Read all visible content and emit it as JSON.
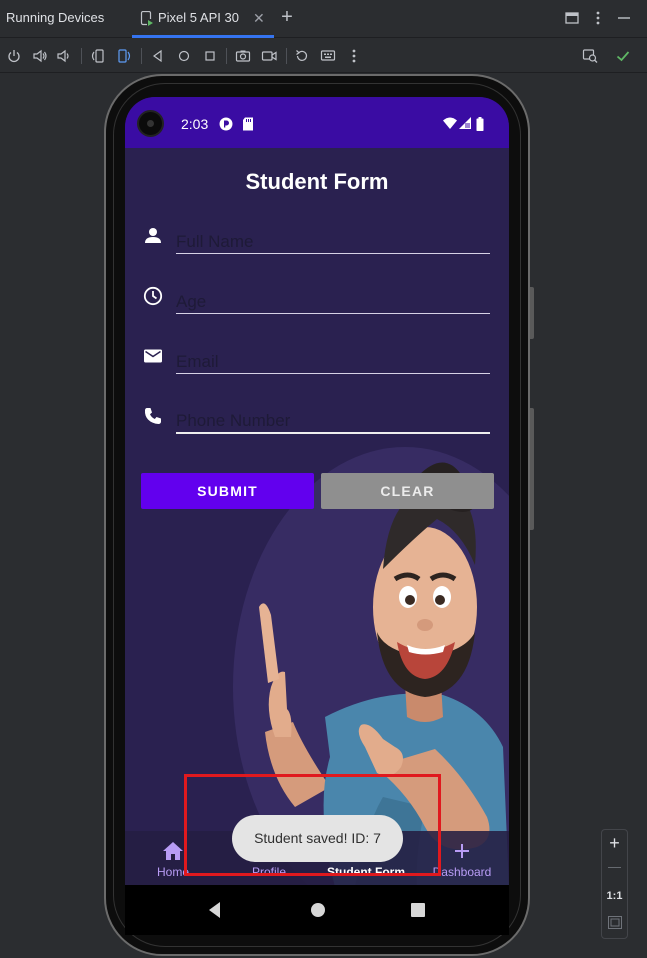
{
  "ide": {
    "panel_title": "Running Devices",
    "tab_label": "Pixel 5 API 30",
    "tab_close": "✕",
    "add_tab": "+"
  },
  "device": {
    "status_time": "2:03"
  },
  "app": {
    "title": "Student Form",
    "fields": {
      "full_name_placeholder": "Full Name",
      "age_placeholder": "Age",
      "email_placeholder": "Email",
      "phone_placeholder": "Phone Number"
    },
    "buttons": {
      "submit": "SUBMIT",
      "clear": "CLEAR"
    },
    "nav": [
      {
        "label": "Home",
        "icon": "home-icon"
      },
      {
        "label": "Profile",
        "icon": "profile-icon"
      },
      {
        "label": "Student Form",
        "icon": "student-form-icon",
        "active": true
      },
      {
        "label": "Dashboard",
        "icon": "add-icon"
      }
    ],
    "toast": "Student saved! ID: 7"
  },
  "zoom": {
    "zoom_in": "+",
    "zoom_out": "—",
    "actual_size": "1:1"
  },
  "colors": {
    "status_bar": "#3a0ca3",
    "screen_bg": "#2a2150",
    "submit": "#6200ee",
    "clear": "#8f8f8f",
    "nav_label": "#b89cf5",
    "highlight": "#e0191e",
    "tab_accent": "#3574f0"
  }
}
